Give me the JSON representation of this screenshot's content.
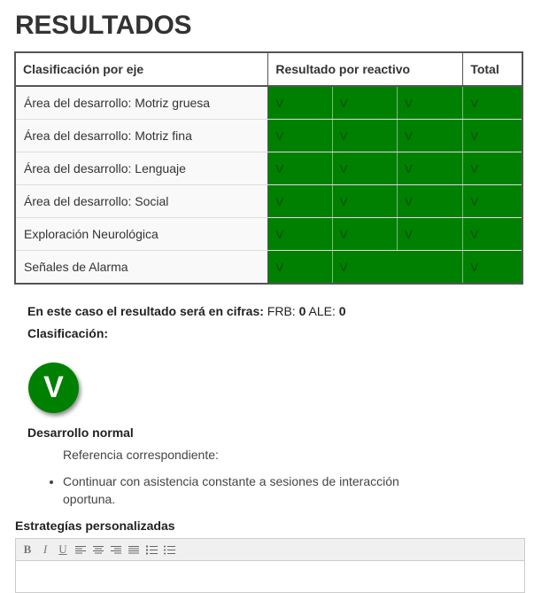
{
  "page_title": "RESULTADOS",
  "table": {
    "headers": [
      "Clasificación por eje",
      "Resultado por reactivo",
      "Total"
    ],
    "rows": [
      {
        "label": "Área del desarrollo: Motriz gruesa",
        "cells": [
          "V",
          "V",
          "V"
        ],
        "total": "V"
      },
      {
        "label": "Área del desarrollo: Motriz fina",
        "cells": [
          "V",
          "V",
          "V"
        ],
        "total": "V"
      },
      {
        "label": "Área del desarrollo: Lenguaje",
        "cells": [
          "V",
          "V",
          "V"
        ],
        "total": "V"
      },
      {
        "label": "Área del desarrollo: Social",
        "cells": [
          "V",
          "V",
          "V"
        ],
        "total": "V"
      },
      {
        "label": "Exploración Neurológica",
        "cells": [
          "V",
          "V",
          "V"
        ],
        "total": "V"
      },
      {
        "label": "Señales de Alarma",
        "cells": [
          "V",
          "V"
        ],
        "total": "V"
      }
    ]
  },
  "summary": {
    "lead": "En este caso el resultado será en cifras:",
    "frb_label": "FRB:",
    "frb_value": "0",
    "ale_label": "ALE:",
    "ale_value": "0"
  },
  "classification_label": "Clasificación:",
  "badge_letter": "V",
  "development_label": "Desarrollo normal",
  "reference_label": "Referencia correspondiente:",
  "recommendations": [
    "Continuar con asistencia constante a sesiones de interacción oportuna."
  ],
  "strategies_title": "Estrategías personalizadas",
  "colors": {
    "result_green": "#008000",
    "border": "#555555"
  },
  "toolbar_icons": [
    "bold-icon",
    "italic-icon",
    "underline-icon",
    "align-left-icon",
    "align-center-icon",
    "align-right-icon",
    "align-justify-icon",
    "ordered-list-icon",
    "unordered-list-icon"
  ]
}
